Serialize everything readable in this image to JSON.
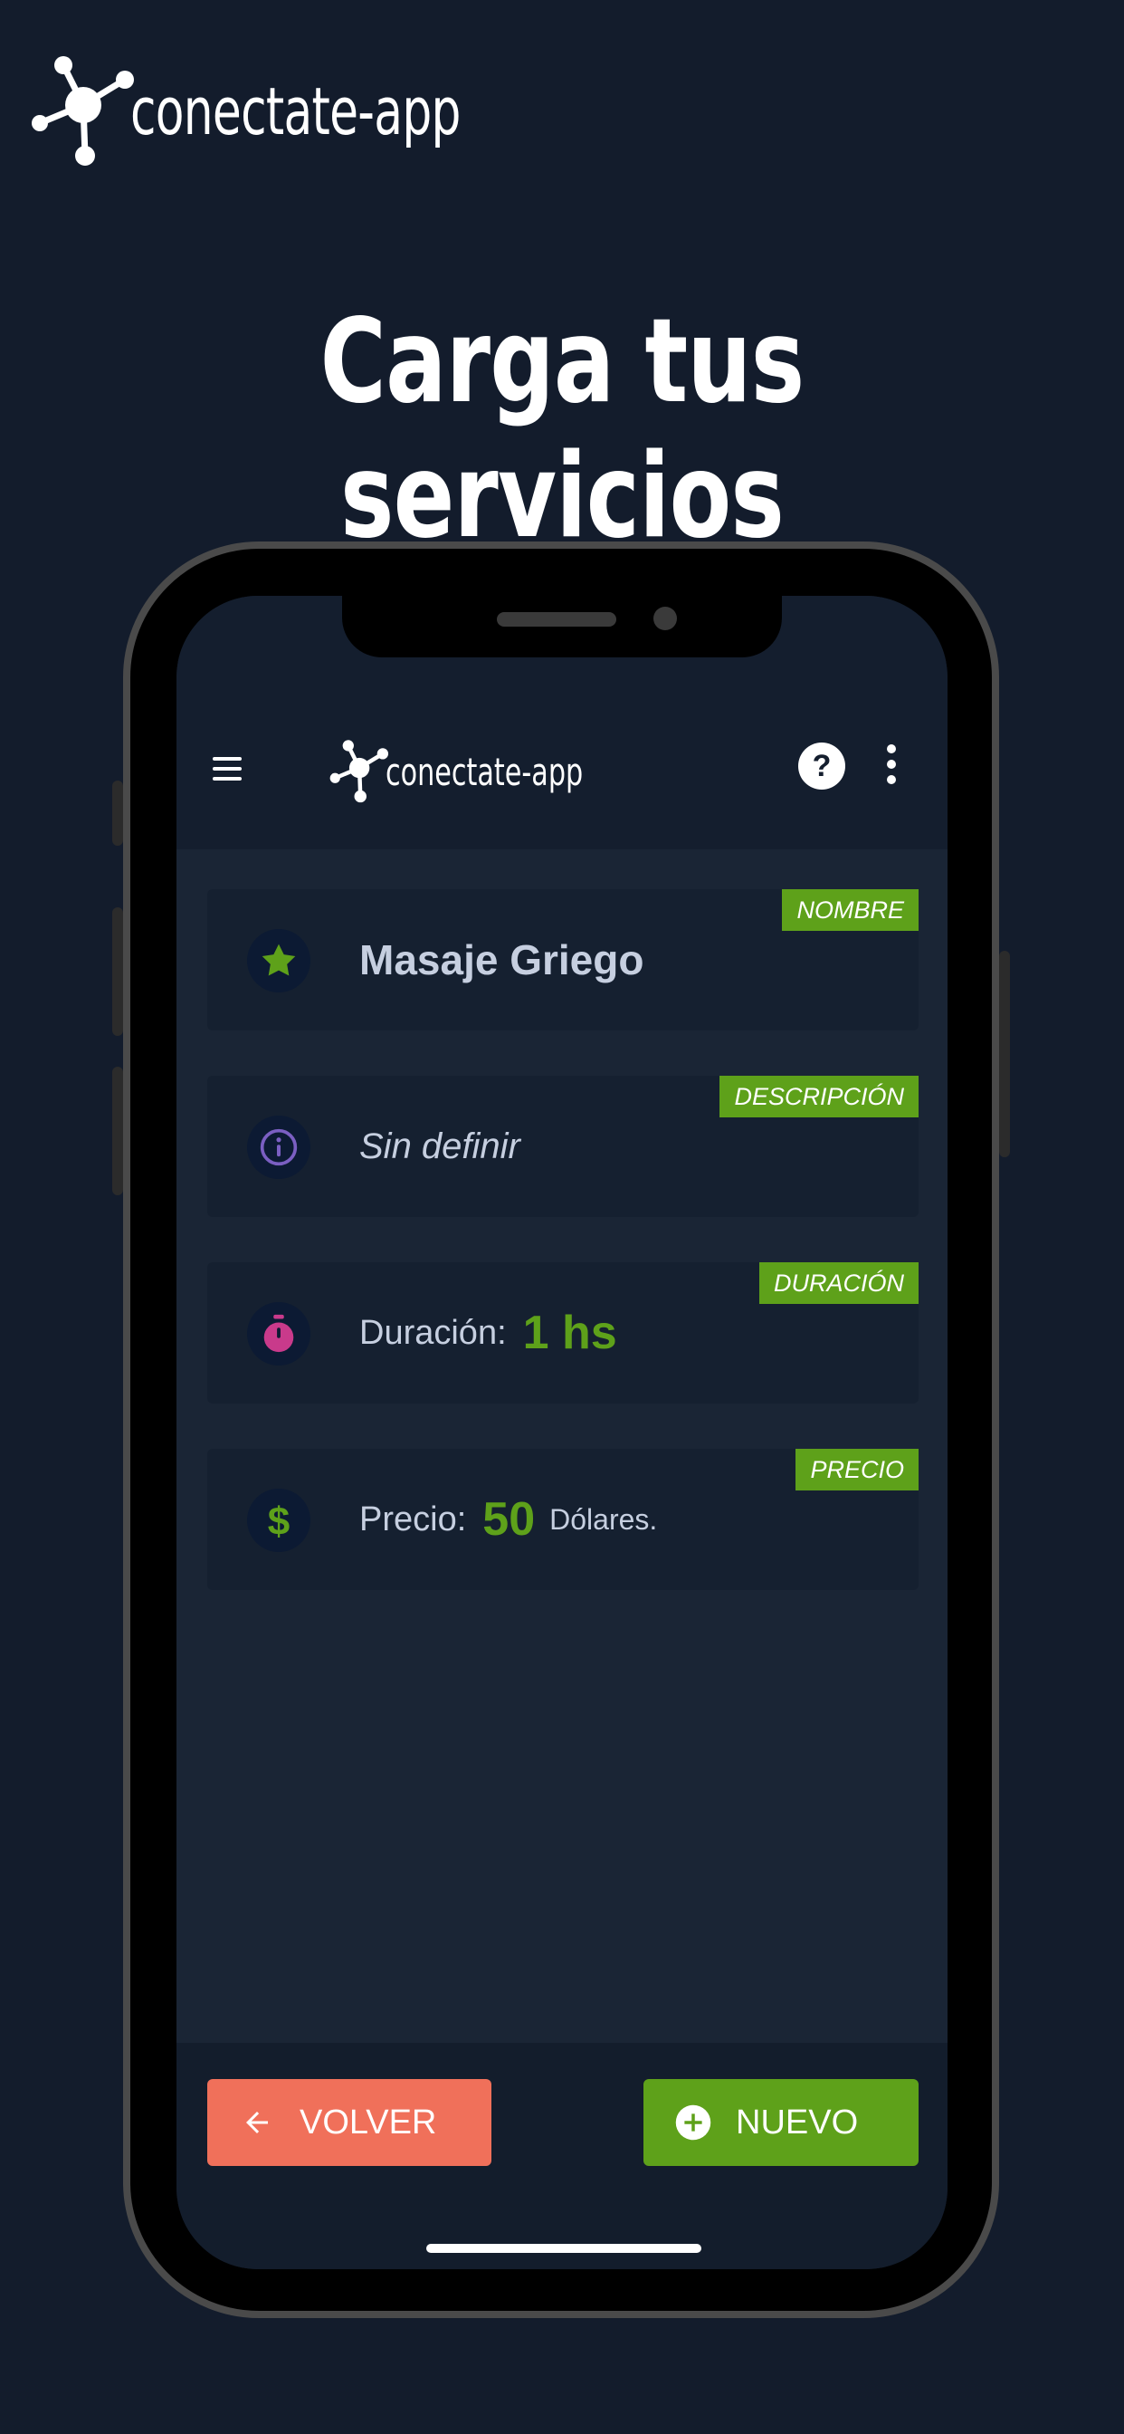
{
  "brand": {
    "name": "conectate-app"
  },
  "headline": "Carga tus servicios",
  "appbar": {
    "logo_text": "conectate-app",
    "help_symbol": "?"
  },
  "cards": [
    {
      "tag": "NOMBRE",
      "icon": "star-icon",
      "title": "Masaje Griego"
    },
    {
      "tag": "DESCRIPCIÓN",
      "icon": "info-icon",
      "description": "Sin definir"
    },
    {
      "tag": "DURACIÓN",
      "icon": "stopwatch-icon",
      "label": "Duración:",
      "value": "1 hs"
    },
    {
      "tag": "PRECIO",
      "icon": "dollar-icon",
      "label": "Precio:",
      "value": "50",
      "unit": "Dólares."
    }
  ],
  "buttons": {
    "back": "VOLVER",
    "new": "NUEVO"
  },
  "colors": {
    "background": "#131c2c",
    "accent_green": "#5ea11a",
    "back_button": "#f0705a",
    "info_icon": "#7b5fc2",
    "stopwatch_icon": "#c93a8b",
    "text": "#c6cfe0"
  }
}
